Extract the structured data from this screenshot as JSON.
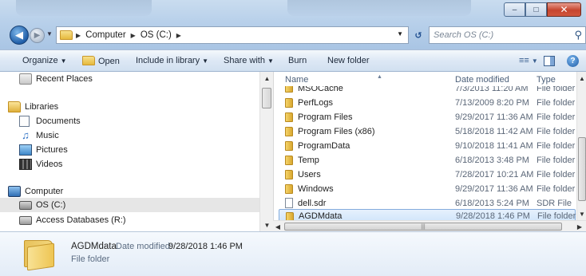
{
  "address": {
    "crumbs": [
      "Computer",
      "OS (C:)"
    ],
    "search_placeholder": "Search OS (C:)"
  },
  "toolbar": {
    "organize": "Organize",
    "open": "Open",
    "include_in_library": "Include in library",
    "share_with": "Share with",
    "burn": "Burn",
    "new_folder": "New folder"
  },
  "nav": {
    "recent_places": "Recent Places",
    "libraries": "Libraries",
    "documents": "Documents",
    "music": "Music",
    "pictures": "Pictures",
    "videos": "Videos",
    "computer": "Computer",
    "os_drive": "OS (C:)",
    "access_db": "Access Databases (R:)"
  },
  "columns": {
    "name": "Name",
    "date_modified": "Date modified",
    "type": "Type"
  },
  "files": [
    {
      "name": "MSOCache",
      "date": "7/3/2013 11:20 AM",
      "type": "File folder"
    },
    {
      "name": "PerfLogs",
      "date": "7/13/2009 8:20 PM",
      "type": "File folder"
    },
    {
      "name": "Program Files",
      "date": "9/29/2017 11:36 AM",
      "type": "File folder"
    },
    {
      "name": "Program Files (x86)",
      "date": "5/18/2018 11:42 AM",
      "type": "File folder"
    },
    {
      "name": "ProgramData",
      "date": "9/10/2018 11:41 AM",
      "type": "File folder"
    },
    {
      "name": "Temp",
      "date": "6/18/2013 3:48 PM",
      "type": "File folder"
    },
    {
      "name": "Users",
      "date": "7/28/2017 10:21 AM",
      "type": "File folder"
    },
    {
      "name": "Windows",
      "date": "9/29/2017 11:36 AM",
      "type": "File folder"
    },
    {
      "name": "dell.sdr",
      "date": "6/18/2013 5:24 PM",
      "type": "SDR File"
    },
    {
      "name": "AGDMdata",
      "date": "9/28/2018 1:46 PM",
      "type": "File folder"
    }
  ],
  "details": {
    "name": "AGDMdata",
    "date_label": "Date modified:",
    "date_value": "9/28/2018 1:46 PM",
    "type": "File folder"
  },
  "icons": {
    "back": "back-arrow-icon",
    "forward": "forward-arrow-icon",
    "search": "magnifier-icon",
    "folder": "folder-icon"
  }
}
